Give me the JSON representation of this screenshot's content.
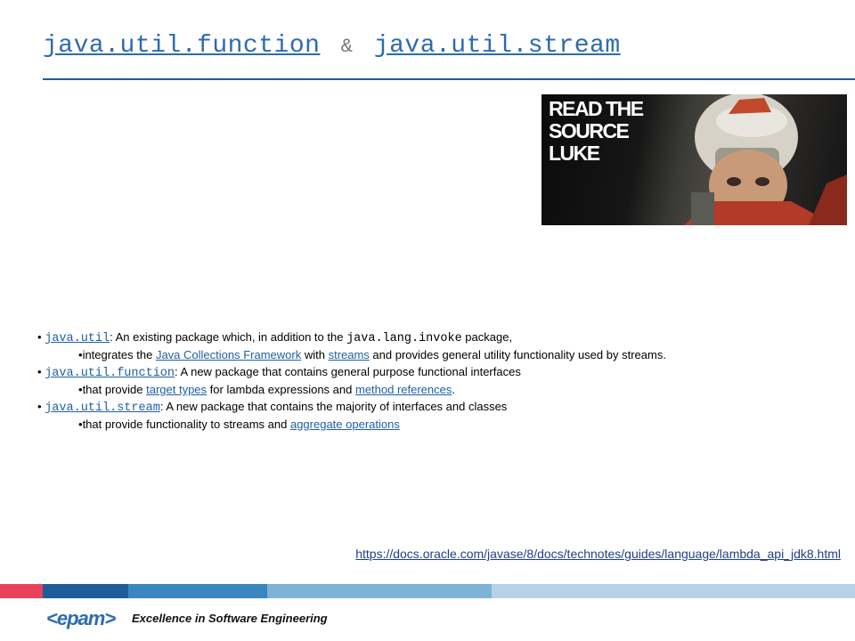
{
  "title": {
    "part1": "java.util.function",
    "separator": "&",
    "part2": "java.util.stream"
  },
  "poster": {
    "line1": "READ THE",
    "line2": "SOURCE",
    "line3": "LUKE"
  },
  "items": [
    {
      "pkg": "java.util",
      "text_a": ": An existing package which, in addition to the ",
      "code": "java.lang.invoke",
      "text_b": " package,",
      "sub": {
        "pre": "integrates the ",
        "link1": "Java Collections Framework",
        "mid": " with ",
        "link2": "streams",
        "post": " and provides general utility functionality used by streams."
      }
    },
    {
      "pkg": "java.util.function",
      "text_a": ": A new package that contains general purpose functional interfaces",
      "sub": {
        "pre": "that provide ",
        "link1": "target types",
        "mid": " for lambda expressions and ",
        "link2": "method references",
        "post": "."
      }
    },
    {
      "pkg": "java.util.stream",
      "text_a": ": A new package that contains the majority of interfaces and classes",
      "sub": {
        "pre": "that provide functionality to streams and ",
        "link1": "aggregate operations"
      }
    }
  ],
  "bullet": "•",
  "doc_link": "https://docs.oracle.com/javase/8/docs/technotes/guides/language/lambda_api_jdk8.html",
  "footer": {
    "logo": "<epam>",
    "slogan": "Excellence in Software Engineering"
  },
  "colors": {
    "title": "#2d6bb1",
    "rule": "#1e5c9a",
    "link": "#1f5fa6",
    "bar": [
      "#e8425a",
      "#1e5c9a",
      "#3a86bf",
      "#7fb3d5",
      "#b5d2e6"
    ]
  }
}
